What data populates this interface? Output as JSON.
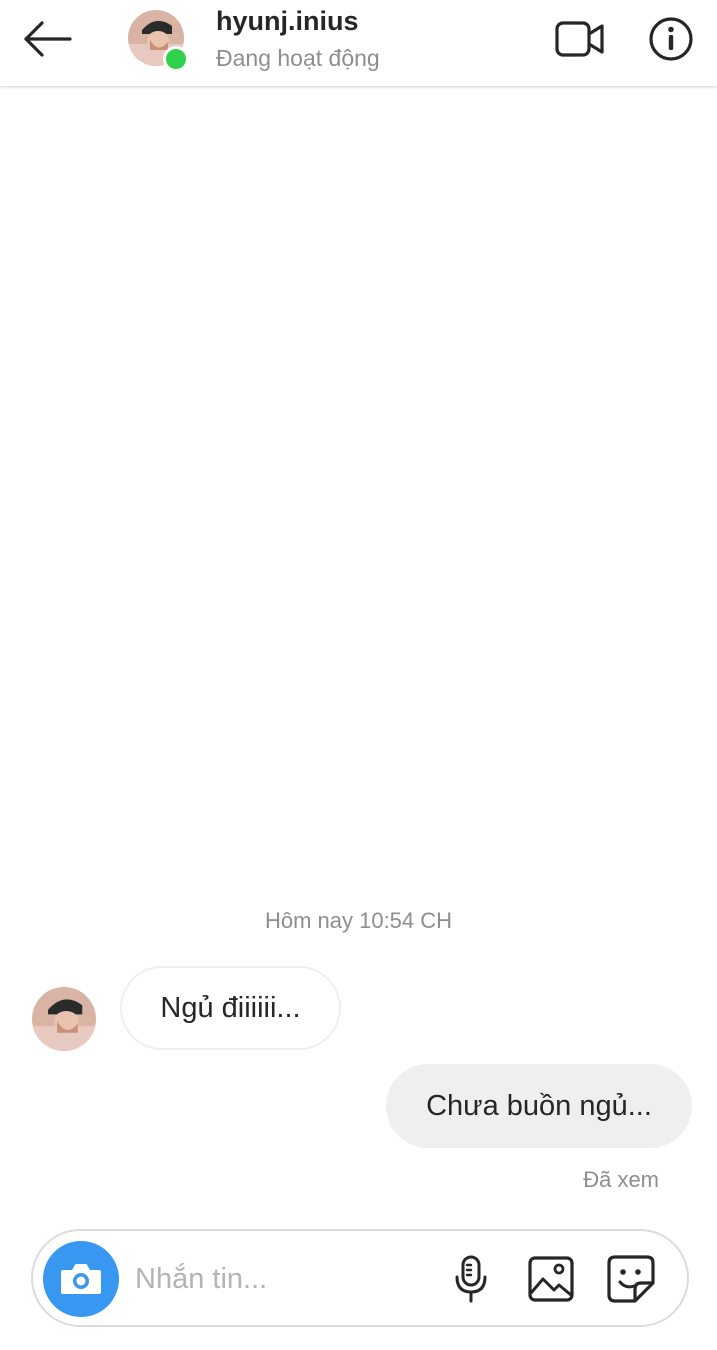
{
  "header": {
    "username": "hyunj.inius",
    "status": "Đang hoạt động",
    "back_icon": "arrow-left-icon",
    "video_icon": "video-camera-icon",
    "info_icon": "info-icon"
  },
  "conversation": {
    "timestamp": "Hôm nay 10:54 CH",
    "messages": [
      {
        "sender": "hyunj.inius",
        "direction": "incoming",
        "text": "Ngủ điiiiii..."
      },
      {
        "sender": "me",
        "direction": "outgoing",
        "text": "Chưa buồn ngủ..."
      }
    ],
    "read_receipt": "Đã xem"
  },
  "composer": {
    "placeholder": "Nhắn tin...",
    "value": "",
    "camera_icon": "camera-icon",
    "mic_icon": "microphone-icon",
    "gallery_icon": "image-gallery-icon",
    "sticker_icon": "sticker-icon"
  },
  "colors": {
    "accent": "#3897f0",
    "online": "#2fd14a",
    "bubble_outgoing": "#efefef",
    "secondary_text": "#8e8e8e"
  }
}
